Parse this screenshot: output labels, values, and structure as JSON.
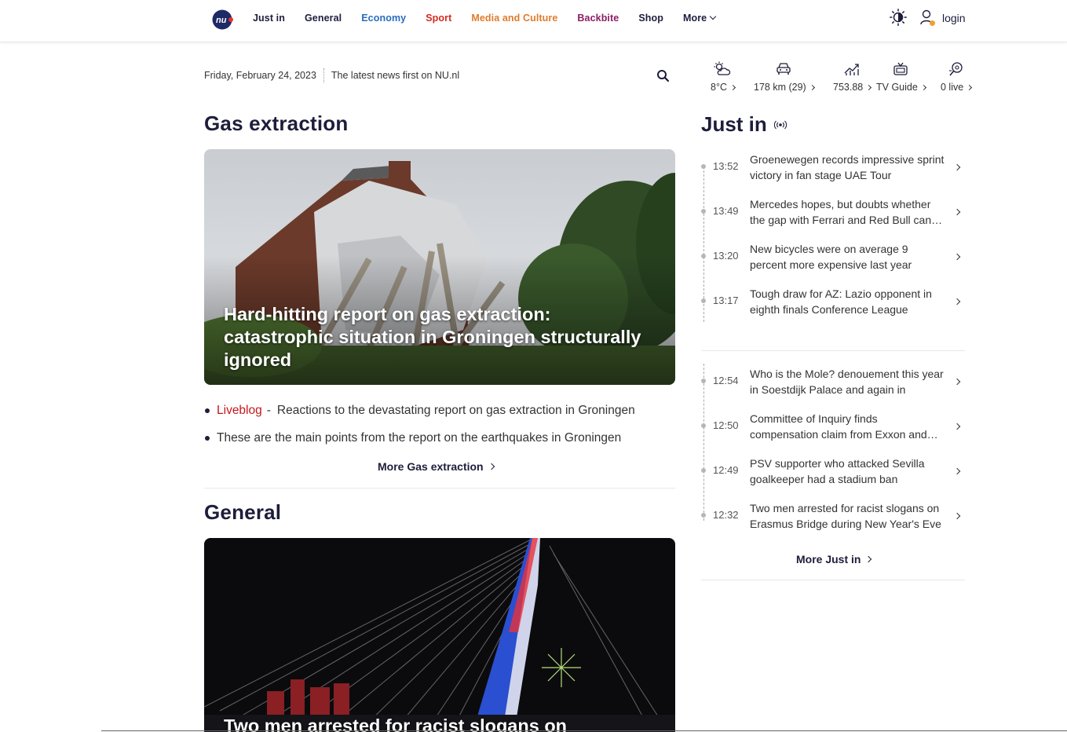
{
  "header": {
    "logo_text": "nu",
    "nav": [
      {
        "label": "Just in",
        "color": "#1d1d3b"
      },
      {
        "label": "General",
        "color": "#1d1d3b"
      },
      {
        "label": "Economy",
        "color": "#2a6cc0"
      },
      {
        "label": "Sport",
        "color": "#d52b1e"
      },
      {
        "label": "Media and Culture",
        "color": "#e07c2c"
      },
      {
        "label": "Backbite",
        "color": "#8b1d63"
      },
      {
        "label": "Shop",
        "color": "#1d1d3b"
      },
      {
        "label": "More",
        "color": "#1d1d3b"
      }
    ],
    "login_label": "login"
  },
  "dateline": {
    "date": "Friday, February 24, 2023",
    "tagline": "The latest news first on NU.nl"
  },
  "widgets": [
    {
      "icon": "weather-icon",
      "label": "8°C"
    },
    {
      "icon": "traffic-icon",
      "label": "178 km (29)"
    },
    {
      "icon": "stocks-icon",
      "label": "753.88"
    },
    {
      "icon": "tv-icon",
      "label": "TV Guide"
    },
    {
      "icon": "live-sport-icon",
      "label": "0 live"
    }
  ],
  "sections": {
    "gas": {
      "title": "Gas extraction",
      "hero_title": "Hard-hitting report on gas extraction: catastrophic situation in Groningen structurally ignored",
      "bullets": [
        {
          "tag": "Liveblog",
          "text": "Reactions to the devastating report on gas extraction in Groningen"
        },
        {
          "tag": "",
          "text": "These are the main points from the report on the earthquakes in Groningen"
        }
      ],
      "more": "More Gas extraction"
    },
    "general": {
      "title": "General",
      "hero_title": "Two men arrested for racist slogans on"
    }
  },
  "justin": {
    "title": "Just in",
    "group1": [
      {
        "time": "13:52",
        "text": "Groenewegen records impressive sprint victory in fan stage UAE Tour"
      },
      {
        "time": "13:49",
        "text": "Mercedes hopes, but doubts whether the gap with Ferrari and Red Bull can be closed"
      },
      {
        "time": "13:20",
        "text": "New bicycles were on average 9 percent more expensive last year"
      },
      {
        "time": "13:17",
        "text": "Tough draw for AZ: Lazio opponent in eighth finals Conference League"
      }
    ],
    "group2": [
      {
        "time": "12:54",
        "text": "Who is the Mole? denouement this year in Soestdijk Palace and again in"
      },
      {
        "time": "12:50",
        "text": "Committee of Inquiry finds compensation claim from Exxon and Shell"
      },
      {
        "time": "12:49",
        "text": "PSV supporter who attacked Sevilla goalkeeper had a stadium ban"
      },
      {
        "time": "12:32",
        "text": "Two men arrested for racist slogans on Erasmus Bridge during New Year's Eve"
      }
    ],
    "more": "More Just in"
  }
}
